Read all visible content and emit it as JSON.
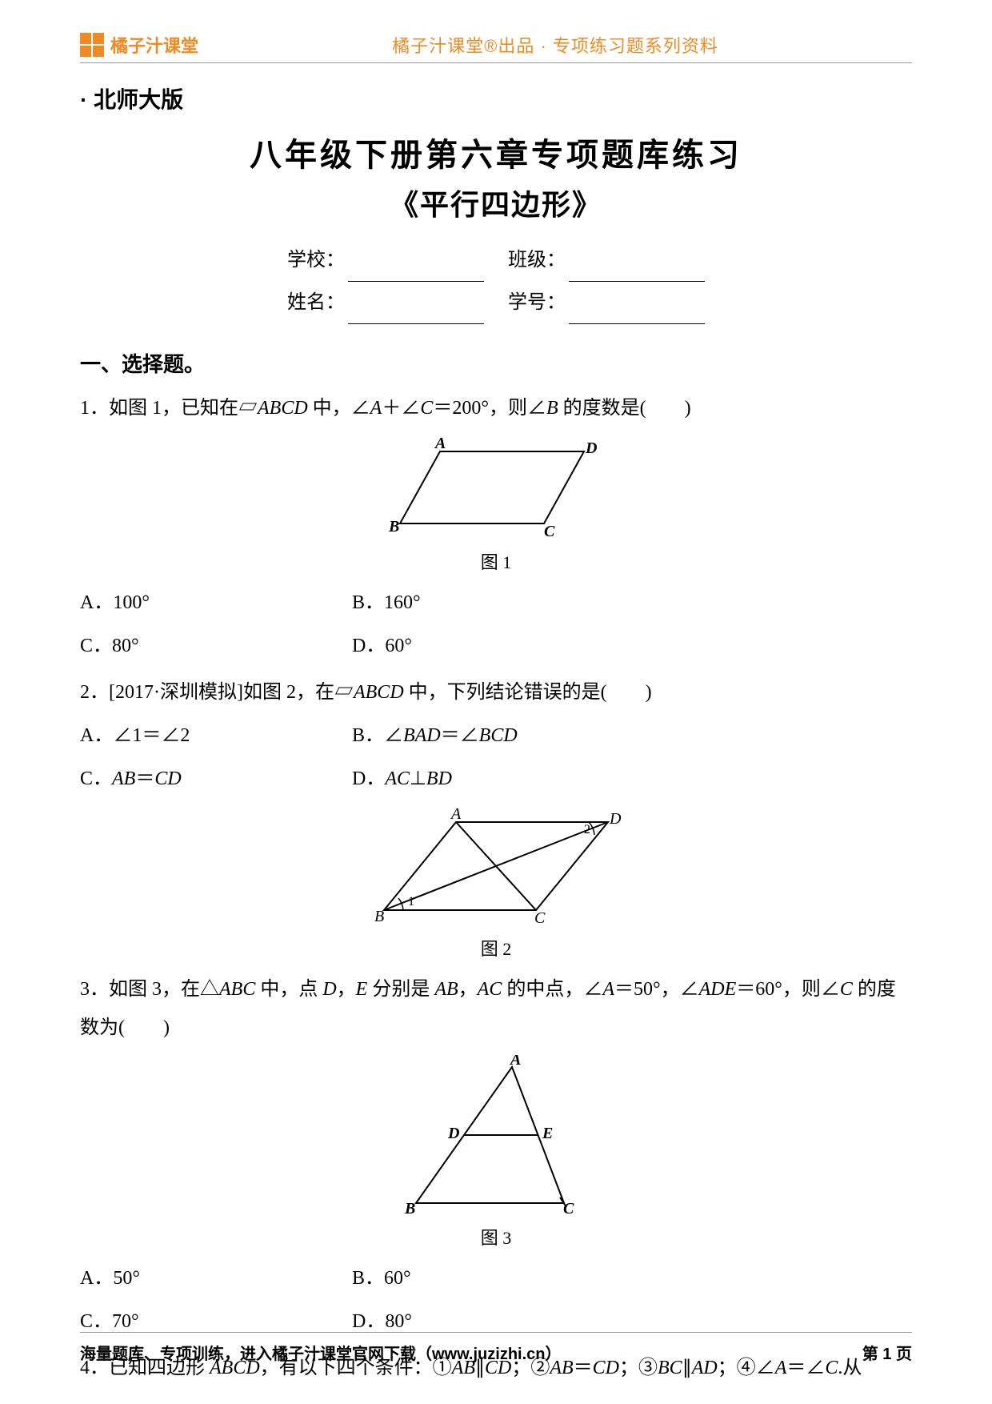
{
  "header": {
    "brand": "橘子汁课堂",
    "center": "橘子汁课堂®出品 · 专项练习题系列资料"
  },
  "version_line": "· 北师大版",
  "title_main": "八年级下册第六章专项题库练习",
  "title_sub": "《平行四边形》",
  "info": {
    "school_label": "学校：",
    "class_label": "班级：",
    "name_label": "姓名：",
    "id_label": "学号："
  },
  "section1": "一、选择题。",
  "q1": {
    "prefix": "1．如图 1，已知在▱",
    "shape": "ABCD",
    "mid": " 中，∠",
    "ang1": "A",
    "plus": "＋∠",
    "ang2": "C",
    "eq": "＝200°，则∠",
    "ang3": "B",
    "tail": " 的度数是(　　)",
    "cap": "图 1",
    "opts": {
      "A": "A．100°",
      "B": "B．160°",
      "C": "C．80°",
      "D": "D．60°"
    }
  },
  "q2": {
    "prefix": "2．[2017·深圳模拟]如图 2，在▱",
    "shape": "ABCD",
    "tail": " 中，下列结论错误的是(　　)",
    "opts": {
      "A_pre": "A．∠1＝∠2",
      "B_pre": "B．∠",
      "B_a": "BAD",
      "B_mid": "＝∠",
      "B_b": "BCD",
      "C_pre": "C．",
      "C_a": "AB",
      "C_mid": "＝",
      "C_b": "CD",
      "D_pre": "D．",
      "D_a": "AC",
      "D_mid": "⊥",
      "D_b": "BD"
    },
    "cap": "图 2"
  },
  "q3": {
    "prefix": "3．如图 3，在△",
    "tri": "ABC",
    "mid1": " 中，点 ",
    "d": "D",
    "comma1": "，",
    "e": "E",
    "mid2": " 分别是 ",
    "ab": "AB",
    "comma2": "，",
    "ac": "AC",
    "mid3": " 的中点，∠",
    "angA": "A",
    "eq1": "＝50°，∠",
    "ade": "ADE",
    "eq2": "＝60°，则∠",
    "angC": "C",
    "tail": " 的度数为(　　)",
    "cap": "图 3",
    "opts": {
      "A": "A．50°",
      "B": "B．60°",
      "C": "C．70°",
      "D": "D．80°"
    }
  },
  "q4": {
    "prefix": "4．已知四边形 ",
    "abcd": "ABCD",
    "mid": "，有以下四个条件：①",
    "c1a": "AB",
    "c1s": "∥",
    "c1b": "CD",
    "sep1": "；②",
    "c2a": "AB",
    "c2s": "＝",
    "c2b": "CD",
    "sep2": "；③",
    "c3a": "BC",
    "c3s": "∥",
    "c3b": "AD",
    "sep3": "；④∠",
    "c4a": "A",
    "c4s": "＝∠",
    "c4b": "C",
    "tail": ".从"
  },
  "footer": {
    "left": "海量题库、专项训练，进入橘子汁课堂官网下载（www.juzizhi.cn）",
    "right": "第 1 页"
  }
}
